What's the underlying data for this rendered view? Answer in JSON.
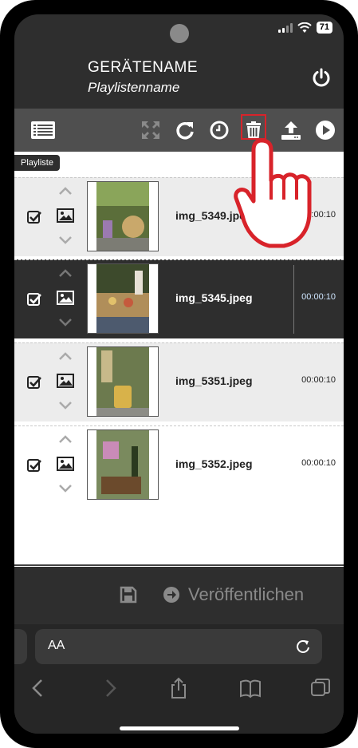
{
  "status": {
    "battery": "71"
  },
  "header": {
    "device_name": "GERÄTENAME",
    "playlist_name": "Playlistenname",
    "power_icon": "power-icon"
  },
  "toolbar": {
    "icons": [
      "list-icon",
      "fullscreen-icon",
      "refresh-icon",
      "clock-icon",
      "trash-icon",
      "upload-icon",
      "play-icon"
    ]
  },
  "tooltip": {
    "label": "Playliste"
  },
  "playlist": {
    "items": [
      {
        "filename": "img_5349.jpeg",
        "duration": "00:00:10",
        "checked": true
      },
      {
        "filename": "img_5345.jpeg",
        "duration": "00:00:10",
        "checked": true
      },
      {
        "filename": "img_5351.jpeg",
        "duration": "00:00:10",
        "checked": true
      },
      {
        "filename": "img_5352.jpeg",
        "duration": "00:00:10",
        "checked": true
      }
    ]
  },
  "footer": {
    "publish_label": "Veröffentlichen"
  },
  "safari": {
    "text_size_label": "AA"
  },
  "colors": {
    "highlight": "#d8232a",
    "toolbar": "#4f4f4f",
    "background": "#2e2e2e"
  }
}
